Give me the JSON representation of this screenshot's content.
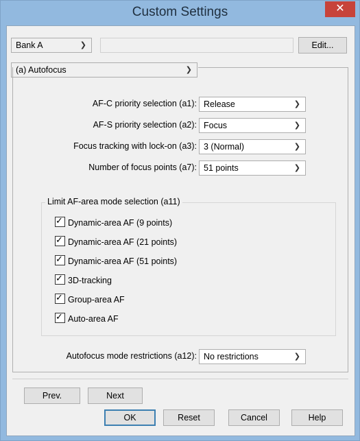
{
  "window": {
    "title": "Custom Settings",
    "close_label": "✕"
  },
  "toolbar": {
    "bank_value": "Bank A",
    "edit_label": "Edit..."
  },
  "category": {
    "value": "(a) Autofocus"
  },
  "settings": [
    {
      "label": "AF-C priority selection (a1):",
      "value": "Release"
    },
    {
      "label": "AF-S priority selection (a2):",
      "value": "Focus"
    },
    {
      "label": "Focus tracking with lock-on (a3):",
      "value": "3 (Normal)"
    },
    {
      "label": "Number of focus points (a7):",
      "value": "51 points"
    }
  ],
  "limit_group": {
    "title": "Limit AF-area mode selection (a11)",
    "items": [
      {
        "label": "Dynamic-area AF (9 points)",
        "checked": true
      },
      {
        "label": "Dynamic-area AF (21 points)",
        "checked": true
      },
      {
        "label": "Dynamic-area AF (51 points)",
        "checked": true
      },
      {
        "label": "3D-tracking",
        "checked": true
      },
      {
        "label": "Group-area AF",
        "checked": true
      },
      {
        "label": "Auto-area AF",
        "checked": true
      }
    ]
  },
  "restrictions": {
    "label": "Autofocus mode restrictions (a12):",
    "value": "No restrictions"
  },
  "nav": {
    "prev_label": "Prev.",
    "next_label": "Next"
  },
  "footer": {
    "ok_label": "OK",
    "reset_label": "Reset",
    "cancel_label": "Cancel",
    "help_label": "Help"
  },
  "check_glyph": "✓"
}
